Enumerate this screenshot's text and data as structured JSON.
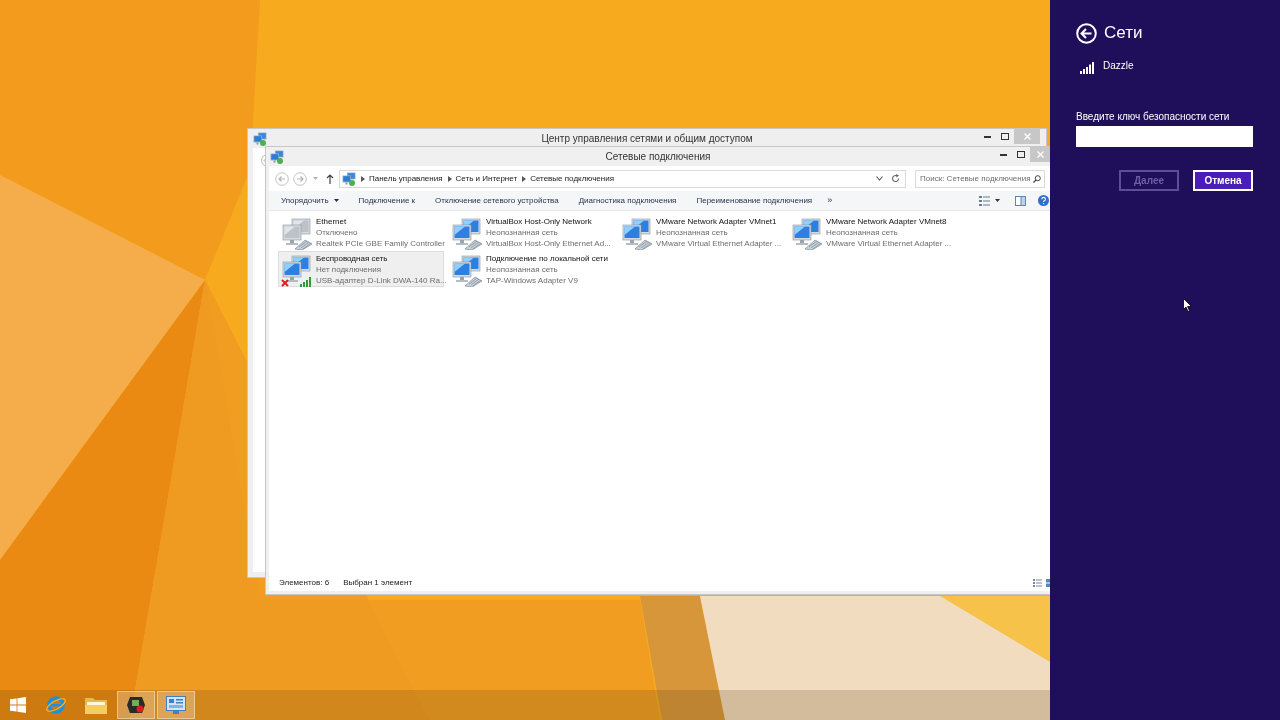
{
  "back_window": {
    "title": "Центр управления сетями и общим доступом"
  },
  "window": {
    "title": "Сетевые подключения",
    "breadcrumb": [
      "Панель управления",
      "Сеть и Интернет",
      "Сетевые подключения"
    ],
    "search": {
      "placeholder": "Поиск: Сетевые подключения"
    },
    "toolbar": [
      {
        "label": "Упорядочить",
        "kind": "menu"
      },
      {
        "label": "Подключение к",
        "kind": "command"
      },
      {
        "label": "Отключение сетевого устройства",
        "kind": "command"
      },
      {
        "label": "Диагностика подключения",
        "kind": "command"
      },
      {
        "label": "Переименование подключения",
        "kind": "command"
      },
      {
        "label": "»",
        "kind": "overflow"
      }
    ],
    "connections": [
      {
        "name": "Ethernet",
        "status": "Отключено",
        "adapter": "Realtek PCIe GBE Family Controller",
        "kind": "wired",
        "disabled": true,
        "not_connected": false,
        "selected": false
      },
      {
        "name": "VirtualBox Host-Only Network",
        "status": "Неопознанная сеть",
        "adapter": "VirtualBox Host-Only Ethernet Ad...",
        "kind": "wired",
        "disabled": false,
        "not_connected": false,
        "selected": false
      },
      {
        "name": "VMware Network Adapter VMnet1",
        "status": "Неопознанная сеть",
        "adapter": "VMware Virtual Ethernet Adapter ...",
        "kind": "wired",
        "disabled": false,
        "not_connected": false,
        "selected": false
      },
      {
        "name": "VMware Network Adapter VMnet8",
        "status": "Неопознанная сеть",
        "adapter": "VMware Virtual Ethernet Adapter ...",
        "kind": "wired",
        "disabled": false,
        "not_connected": false,
        "selected": false
      },
      {
        "name": "Беспроводная сеть",
        "status": "Нет подключения",
        "adapter": "USB-адаптер D-Link DWA-140 Ra...",
        "kind": "wireless",
        "disabled": false,
        "not_connected": true,
        "selected": true
      },
      {
        "name": "Подключение по локальной сети",
        "status": "Неопознанная сеть",
        "adapter": "TAP-Windows Adapter V9",
        "kind": "wired",
        "disabled": false,
        "not_connected": false,
        "selected": false
      }
    ],
    "status_bar": {
      "count": "Элементов: 6",
      "selection": "Выбран 1 элемент"
    }
  },
  "network_panel": {
    "title": "Сети",
    "network": "Dazzle",
    "key_label": "Введите ключ безопасности сети",
    "buttons": [
      {
        "label": "Далее",
        "disabled": true
      },
      {
        "label": "Отмена",
        "disabled": false
      }
    ]
  },
  "taskbar": {
    "apps": [
      {
        "kind": "browser",
        "active": false
      },
      {
        "kind": "folder",
        "active": false
      },
      {
        "kind": "recorder",
        "active": true
      },
      {
        "kind": "network",
        "active": true
      }
    ]
  }
}
